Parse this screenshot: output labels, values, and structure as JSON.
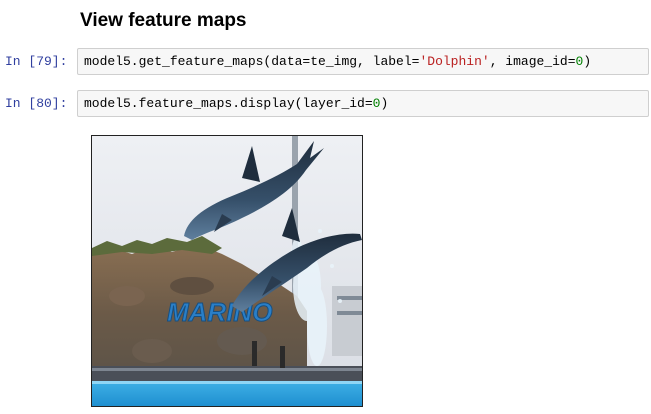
{
  "section": {
    "heading": "View feature maps"
  },
  "cells": [
    {
      "prompt": "In [79]:",
      "code_prefix": "model5.get_feature_maps(data=te_img, label=",
      "code_string": "'Dolphin'",
      "code_middle": ", image_id=",
      "code_number": "0",
      "code_suffix": ")"
    },
    {
      "prompt": "In [80]:",
      "code_prefix": "model5.feature_maps.display(layer_id=",
      "code_number": "0",
      "code_suffix": ")"
    }
  ],
  "output": {
    "image_subject": "dolphin-show-photo",
    "sign_text": "MARINO"
  },
  "colors": {
    "prompt": "#303f9f",
    "string": "#ba2121",
    "number": "#008000",
    "cell_background": "#f7f7f7",
    "cell_border": "#cfcfcf"
  }
}
